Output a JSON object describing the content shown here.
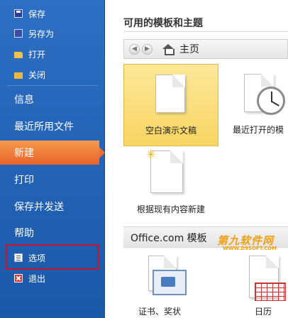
{
  "sidebar": {
    "file_items": [
      {
        "label": "保存",
        "icon": "save-icon"
      },
      {
        "label": "另存为",
        "icon": "save-as-icon"
      },
      {
        "label": "打开",
        "icon": "open-folder-icon"
      },
      {
        "label": "关闭",
        "icon": "close-folder-icon"
      }
    ],
    "main_items": [
      {
        "label": "信息"
      },
      {
        "label": "最近所用文件"
      },
      {
        "label": "新建",
        "active": true
      },
      {
        "label": "打印"
      },
      {
        "label": "保存并发送"
      },
      {
        "label": "帮助"
      }
    ],
    "bottom_items": [
      {
        "label": "选项",
        "icon": "options-icon"
      },
      {
        "label": "退出",
        "icon": "exit-icon"
      }
    ],
    "colors": {
      "background": "#1b58a8",
      "active": "#e9632a",
      "highlight_box": "#c9152a"
    }
  },
  "main": {
    "section_title": "可用的模板和主题",
    "nav": {
      "back_icon": "back-arrow-icon",
      "forward_icon": "forward-arrow-icon",
      "home_icon": "home-icon",
      "location": "主页"
    },
    "templates": [
      {
        "label": "空白演示文稿",
        "selected": true
      },
      {
        "label": "最近打开的模",
        "selected": false
      },
      {
        "label": "根据现有内容新建",
        "selected": false
      }
    ],
    "office_section": {
      "title": "Office.com 模板",
      "items": [
        {
          "label": "证书、奖状"
        },
        {
          "label": "日历"
        }
      ]
    },
    "watermark": {
      "text": "第九软件网",
      "url": "WWW.D9SOFT.COM"
    }
  }
}
